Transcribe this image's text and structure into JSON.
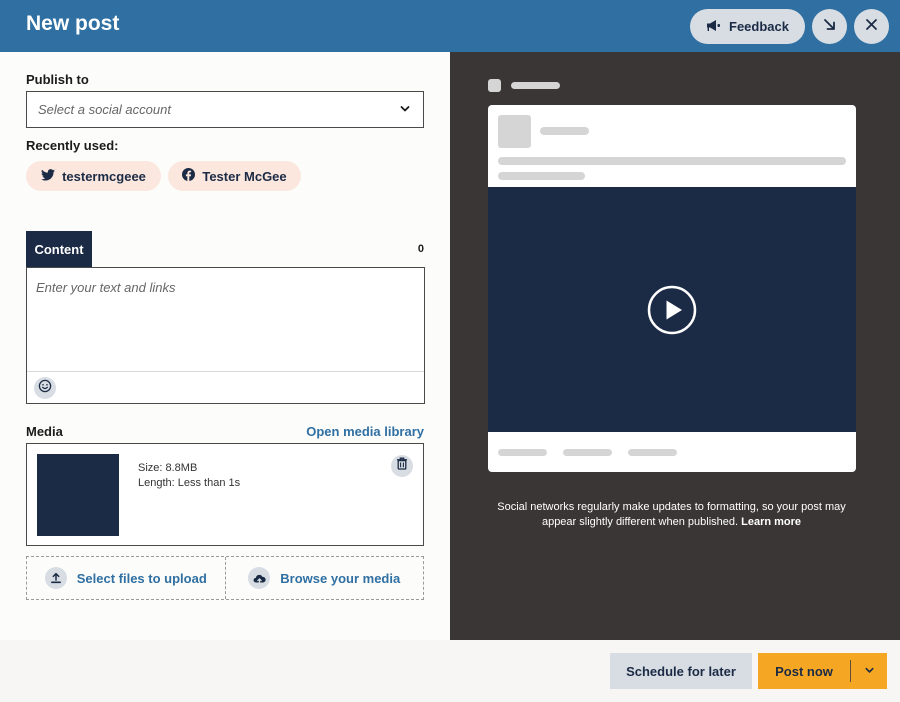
{
  "header": {
    "title": "New post",
    "feedback_label": "Feedback",
    "icons": {
      "feedback": "megaphone-icon",
      "minimize": "arrow-down-right-icon",
      "close": "close-icon"
    },
    "colors": {
      "background": "#2f6fa2",
      "button": "#d7dde3"
    }
  },
  "publish": {
    "label": "Publish to",
    "placeholder": "Select a social account",
    "recent_label": "Recently used:",
    "recent": [
      {
        "label": "testermcgeee",
        "icon": "twitter-icon"
      },
      {
        "label": "Tester McGee",
        "icon": "facebook-icon"
      }
    ]
  },
  "content": {
    "tab_label": "Content",
    "char_count": "0",
    "placeholder": "Enter your text and links"
  },
  "media": {
    "label": "Media",
    "library_link": "Open media library",
    "item": {
      "size": "Size: 8.8MB",
      "length": "Length: Less than 1s"
    },
    "upload_label": "Select files to upload",
    "browse_label": "Browse your media"
  },
  "preview": {
    "note": "Social networks regularly make updates to formatting, so your post may appear slightly different when published.",
    "learn_more": "Learn more"
  },
  "footer": {
    "schedule_label": "Schedule for later",
    "post_label": "Post now"
  },
  "colors": {
    "accent": "#2f6fa2",
    "navy": "#1c2b45",
    "post_button": "#f5a623",
    "chip": "#fbe7de",
    "preview_bg": "#3a3635"
  }
}
